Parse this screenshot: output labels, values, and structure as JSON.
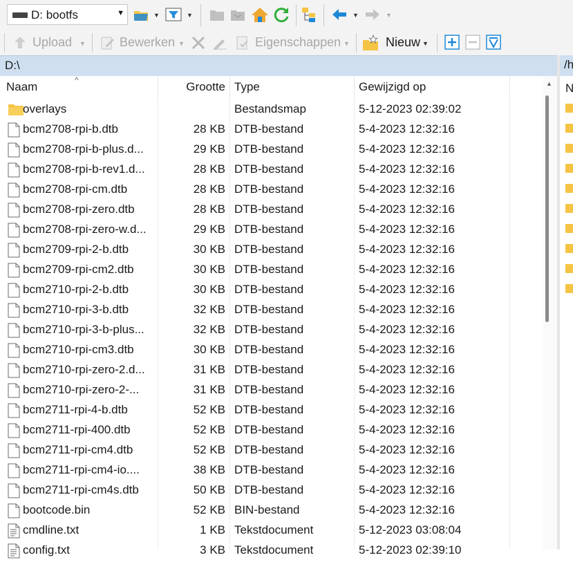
{
  "toolbar": {
    "drive_label": "D: bootfs",
    "upload_label": "Upload",
    "edit_label": "Bewerken",
    "properties_label": "Eigenschappen",
    "new_label": "Nieuw"
  },
  "local": {
    "path": "D:\\",
    "columns": {
      "name": "Naam",
      "size": "Grootte",
      "type": "Type",
      "modified": "Gewijzigd op"
    },
    "files": [
      {
        "name": "overlays",
        "size": "",
        "type": "Bestandsmap",
        "modified": "5-12-2023 02:39:02",
        "icon": "folder-icon"
      },
      {
        "name": "bcm2708-rpi-b.dtb",
        "size": "28 KB",
        "type": "DTB-bestand",
        "modified": "5-4-2023 12:32:16",
        "icon": "file-icon"
      },
      {
        "name": "bcm2708-rpi-b-plus.d...",
        "size": "29 KB",
        "type": "DTB-bestand",
        "modified": "5-4-2023 12:32:16",
        "icon": "file-icon"
      },
      {
        "name": "bcm2708-rpi-b-rev1.d...",
        "size": "28 KB",
        "type": "DTB-bestand",
        "modified": "5-4-2023 12:32:16",
        "icon": "file-icon"
      },
      {
        "name": "bcm2708-rpi-cm.dtb",
        "size": "28 KB",
        "type": "DTB-bestand",
        "modified": "5-4-2023 12:32:16",
        "icon": "file-icon"
      },
      {
        "name": "bcm2708-rpi-zero.dtb",
        "size": "28 KB",
        "type": "DTB-bestand",
        "modified": "5-4-2023 12:32:16",
        "icon": "file-icon"
      },
      {
        "name": "bcm2708-rpi-zero-w.d...",
        "size": "29 KB",
        "type": "DTB-bestand",
        "modified": "5-4-2023 12:32:16",
        "icon": "file-icon"
      },
      {
        "name": "bcm2709-rpi-2-b.dtb",
        "size": "30 KB",
        "type": "DTB-bestand",
        "modified": "5-4-2023 12:32:16",
        "icon": "file-icon"
      },
      {
        "name": "bcm2709-rpi-cm2.dtb",
        "size": "30 KB",
        "type": "DTB-bestand",
        "modified": "5-4-2023 12:32:16",
        "icon": "file-icon"
      },
      {
        "name": "bcm2710-rpi-2-b.dtb",
        "size": "30 KB",
        "type": "DTB-bestand",
        "modified": "5-4-2023 12:32:16",
        "icon": "file-icon"
      },
      {
        "name": "bcm2710-rpi-3-b.dtb",
        "size": "32 KB",
        "type": "DTB-bestand",
        "modified": "5-4-2023 12:32:16",
        "icon": "file-icon"
      },
      {
        "name": "bcm2710-rpi-3-b-plus...",
        "size": "32 KB",
        "type": "DTB-bestand",
        "modified": "5-4-2023 12:32:16",
        "icon": "file-icon"
      },
      {
        "name": "bcm2710-rpi-cm3.dtb",
        "size": "30 KB",
        "type": "DTB-bestand",
        "modified": "5-4-2023 12:32:16",
        "icon": "file-icon"
      },
      {
        "name": "bcm2710-rpi-zero-2.d...",
        "size": "31 KB",
        "type": "DTB-bestand",
        "modified": "5-4-2023 12:32:16",
        "icon": "file-icon"
      },
      {
        "name": "bcm2710-rpi-zero-2-...",
        "size": "31 KB",
        "type": "DTB-bestand",
        "modified": "5-4-2023 12:32:16",
        "icon": "file-icon"
      },
      {
        "name": "bcm2711-rpi-4-b.dtb",
        "size": "52 KB",
        "type": "DTB-bestand",
        "modified": "5-4-2023 12:32:16",
        "icon": "file-icon"
      },
      {
        "name": "bcm2711-rpi-400.dtb",
        "size": "52 KB",
        "type": "DTB-bestand",
        "modified": "5-4-2023 12:32:16",
        "icon": "file-icon"
      },
      {
        "name": "bcm2711-rpi-cm4.dtb",
        "size": "52 KB",
        "type": "DTB-bestand",
        "modified": "5-4-2023 12:32:16",
        "icon": "file-icon"
      },
      {
        "name": "bcm2711-rpi-cm4-io....",
        "size": "38 KB",
        "type": "DTB-bestand",
        "modified": "5-4-2023 12:32:16",
        "icon": "file-icon"
      },
      {
        "name": "bcm2711-rpi-cm4s.dtb",
        "size": "50 KB",
        "type": "DTB-bestand",
        "modified": "5-4-2023 12:32:16",
        "icon": "file-icon"
      },
      {
        "name": "bootcode.bin",
        "size": "52 KB",
        "type": "BIN-bestand",
        "modified": "5-4-2023 12:32:16",
        "icon": "file-icon"
      },
      {
        "name": "cmdline.txt",
        "size": "1 KB",
        "type": "Tekstdocument",
        "modified": "5-12-2023 03:08:04",
        "icon": "text-file-icon"
      },
      {
        "name": "config.txt",
        "size": "3 KB",
        "type": "Tekstdocument",
        "modified": "5-12-2023 02:39:10",
        "icon": "text-file-icon"
      }
    ]
  },
  "remote": {
    "path": "/h",
    "column_name": "N"
  },
  "colors": {
    "path_bar": "#cfdff0",
    "folder": "#f6c445",
    "accent_blue": "#1e88d8"
  }
}
